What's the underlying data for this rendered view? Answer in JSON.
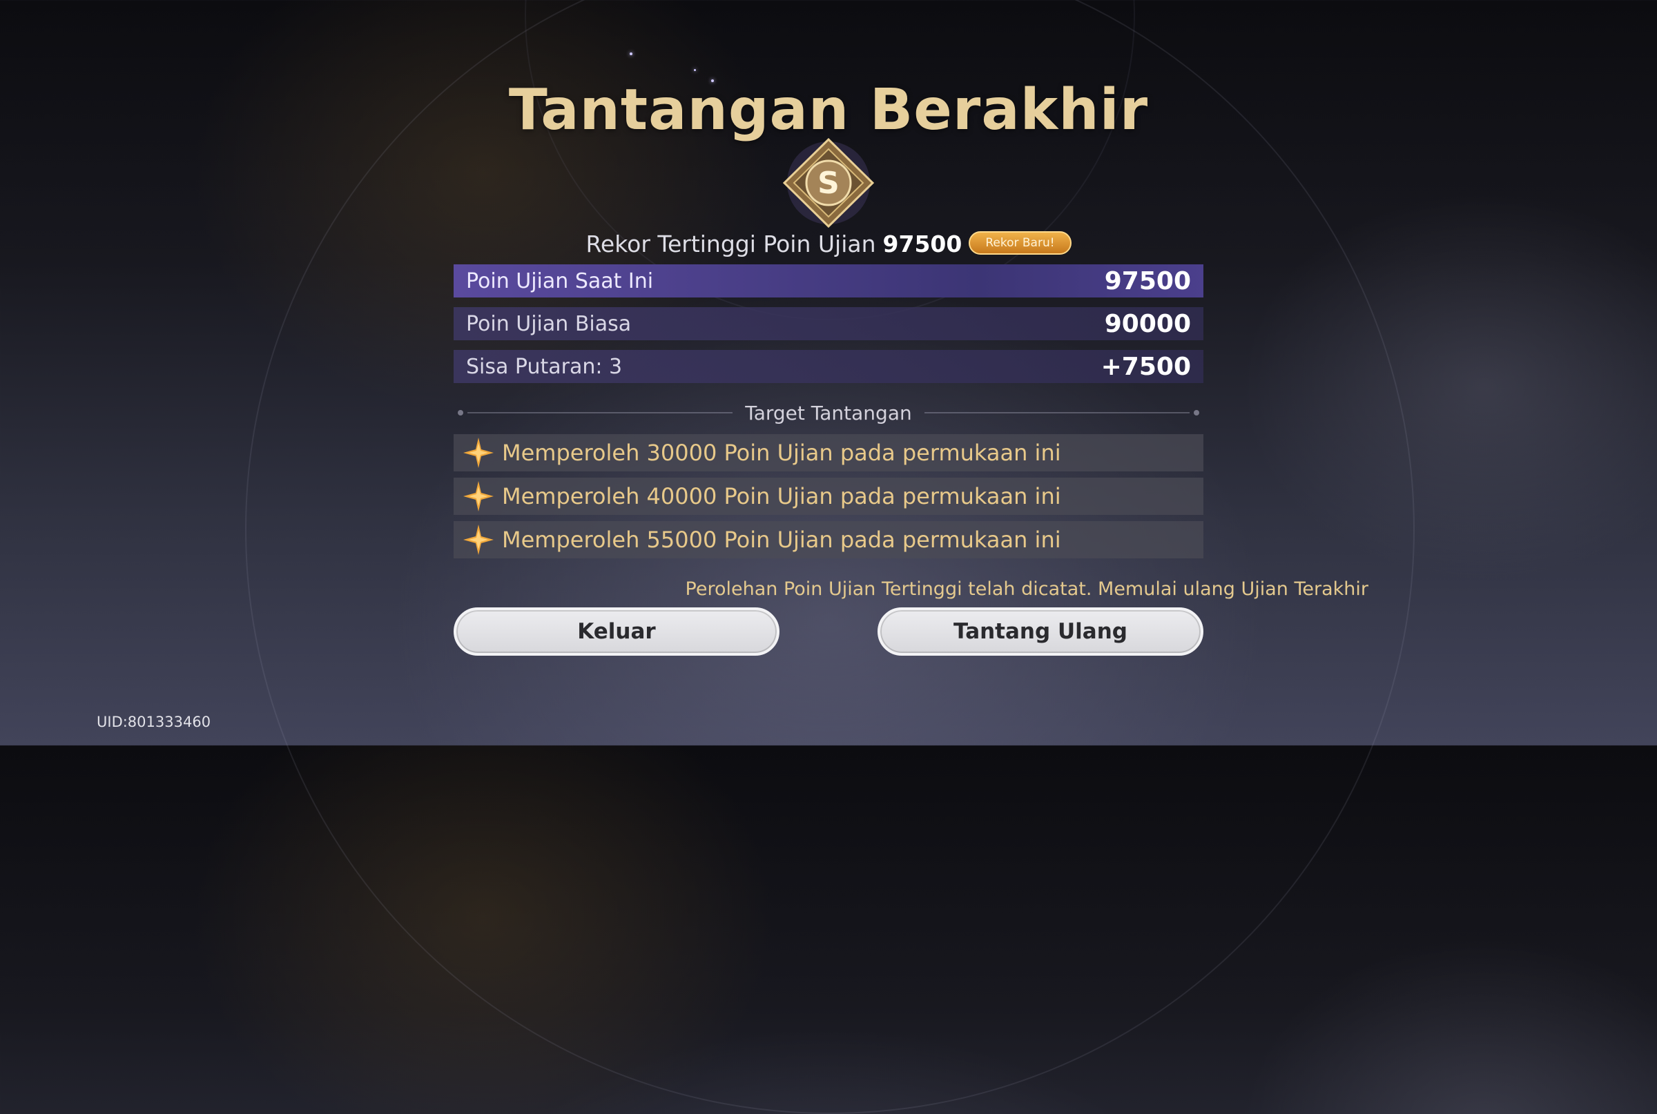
{
  "title": "Tantangan Berakhir",
  "rank": "S",
  "record": {
    "label": "Rekor Tertinggi Poin Ujian",
    "value": "97500",
    "badge": "Rekor Baru!"
  },
  "scores": [
    {
      "label": "Poin Ujian Saat Ini",
      "value": "97500"
    },
    {
      "label": "Poin Ujian Biasa",
      "value": "90000"
    },
    {
      "label": "Sisa Putaran: 3",
      "value": "+7500"
    }
  ],
  "targets_heading": "Target Tantangan",
  "targets": [
    {
      "text": "Memperoleh 30000 Poin Ujian pada permukaan ini",
      "icon": "star-icon"
    },
    {
      "text": "Memperoleh 40000 Poin Ujian pada permukaan ini",
      "icon": "star-icon"
    },
    {
      "text": "Memperoleh 55000 Poin Ujian pada permukaan ini",
      "icon": "star-icon"
    }
  ],
  "notice": "Perolehan Poin Ujian Tertinggi telah dicatat. Memulai ulang Ujian Terakhir",
  "buttons": {
    "exit": "Keluar",
    "retry": "Tantang Ulang"
  },
  "uid": "UID:801333460",
  "colors": {
    "title": "#e6cf9c",
    "highlight_row": "#5a4a9e",
    "goal_text": "#e8c98a",
    "badge": "#e59b36"
  }
}
